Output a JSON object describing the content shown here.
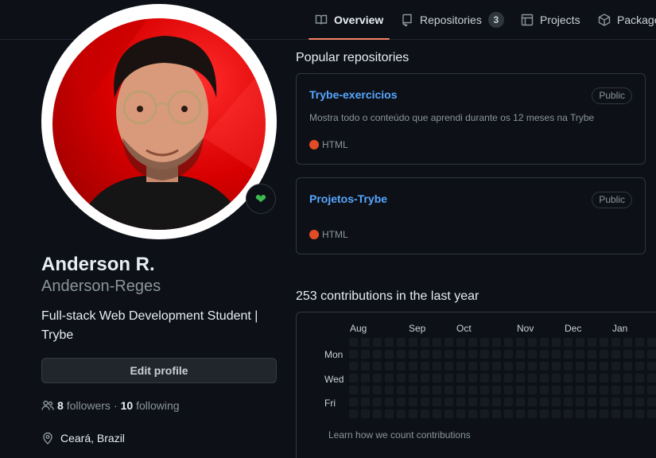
{
  "nav": {
    "tabs": [
      {
        "label": "Overview",
        "icon": "book-icon"
      },
      {
        "label": "Repositories",
        "icon": "repo-icon",
        "count": "3"
      },
      {
        "label": "Projects",
        "icon": "table-icon"
      },
      {
        "label": "Packages",
        "icon": "package-icon"
      }
    ]
  },
  "profile": {
    "name": "Anderson R.",
    "login": "Anderson-Reges",
    "bio": "Full-stack Web Development Student | Trybe",
    "edit_label": "Edit profile",
    "followers_count": "8",
    "followers_label": "followers",
    "separator": "·",
    "following_count": "10",
    "following_label": "following",
    "location": "Ceará, Brazil",
    "status_icon": "green-heart-icon",
    "avatar_colors": {
      "background": "#d80000",
      "ring": "#ffffff"
    }
  },
  "popular": {
    "title": "Popular repositories",
    "repos": [
      {
        "name": "Trybe-exercicios",
        "visibility": "Public",
        "description": "Mostra todo o conteúdo que aprendi durante os 12 meses na Trybe",
        "language": "HTML",
        "language_color": "#e34c26"
      },
      {
        "name": "Projetos-Trybe",
        "visibility": "Public",
        "description": "",
        "language": "HTML",
        "language_color": "#e34c26"
      }
    ]
  },
  "contributions": {
    "title": "253 contributions in the last year",
    "months": [
      "Aug",
      "Sep",
      "Oct",
      "Nov",
      "Dec",
      "Jan"
    ],
    "days": [
      "Mon",
      "Wed",
      "Fri"
    ],
    "learn_link": "Learn how we count contributions",
    "colors": {
      "empty": "#161b22",
      "level1": "#0e4429",
      "level2": "#006d32"
    }
  }
}
